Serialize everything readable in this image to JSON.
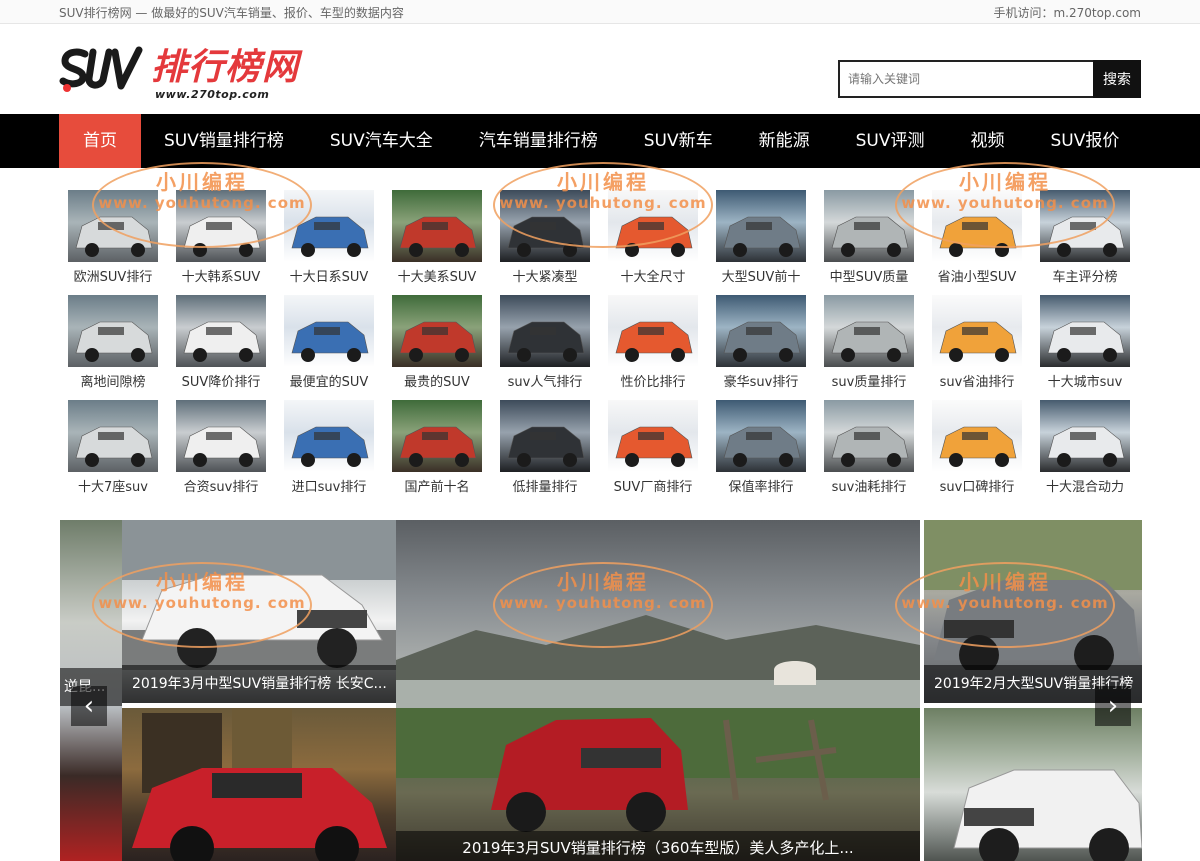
{
  "topbar": {
    "left": "SUV排行榜网 — 做最好的SUV汽车销量、报价、车型的数据内容",
    "right": "手机访问：m.270top.com"
  },
  "logo": {
    "suv": "SUV",
    "cn": "排行榜网",
    "url": "www.270top.com"
  },
  "search": {
    "placeholder": "请输入关键词",
    "button": "搜索"
  },
  "nav": [
    "首页",
    "SUV销量排行榜",
    "SUV汽车大全",
    "汽车销量排行榜",
    "SUV新车",
    "新能源",
    "SUV评测",
    "视频",
    "SUV报价"
  ],
  "grid": [
    "欧洲SUV排行",
    "十大韩系SUV",
    "十大日系SUV",
    "十大美系SUV",
    "十大紧凑型",
    "十大全尺寸",
    "大型SUV前十",
    "中型SUV质量",
    "省油小型SUV",
    "车主评分榜",
    "离地间隙榜",
    "SUV降价排行",
    "最便宜的SUV",
    "最贵的SUV",
    "suv人气排行",
    "性价比排行",
    "豪华suv排行",
    "suv质量排行",
    "suv省油排行",
    "十大城市suv",
    "十大7座suv",
    "合资suv排行",
    "进口suv排行",
    "国产前十名",
    "低排量排行",
    "SUV厂商排行",
    "保值率排行",
    "suv油耗排行",
    "suv口碑排行",
    "十大混合动力"
  ],
  "slider": {
    "left_top_caption": "2019年3月中型SUV销量排行榜 长安C...",
    "left_edge_caption": "逆昆...",
    "right_top_caption": "2019年2月大型SUV销量排行榜",
    "center_caption": "2019年3月SUV销量排行榜（360车型版）美人多产化上...",
    "prev": "‹",
    "next": "›"
  },
  "watermark": {
    "cn": "小川编程",
    "en": "www. youhutong. com"
  },
  "colors": {
    "accent": "#e74c3c",
    "nav_bg": "#000000",
    "watermark": "#f3904a"
  }
}
